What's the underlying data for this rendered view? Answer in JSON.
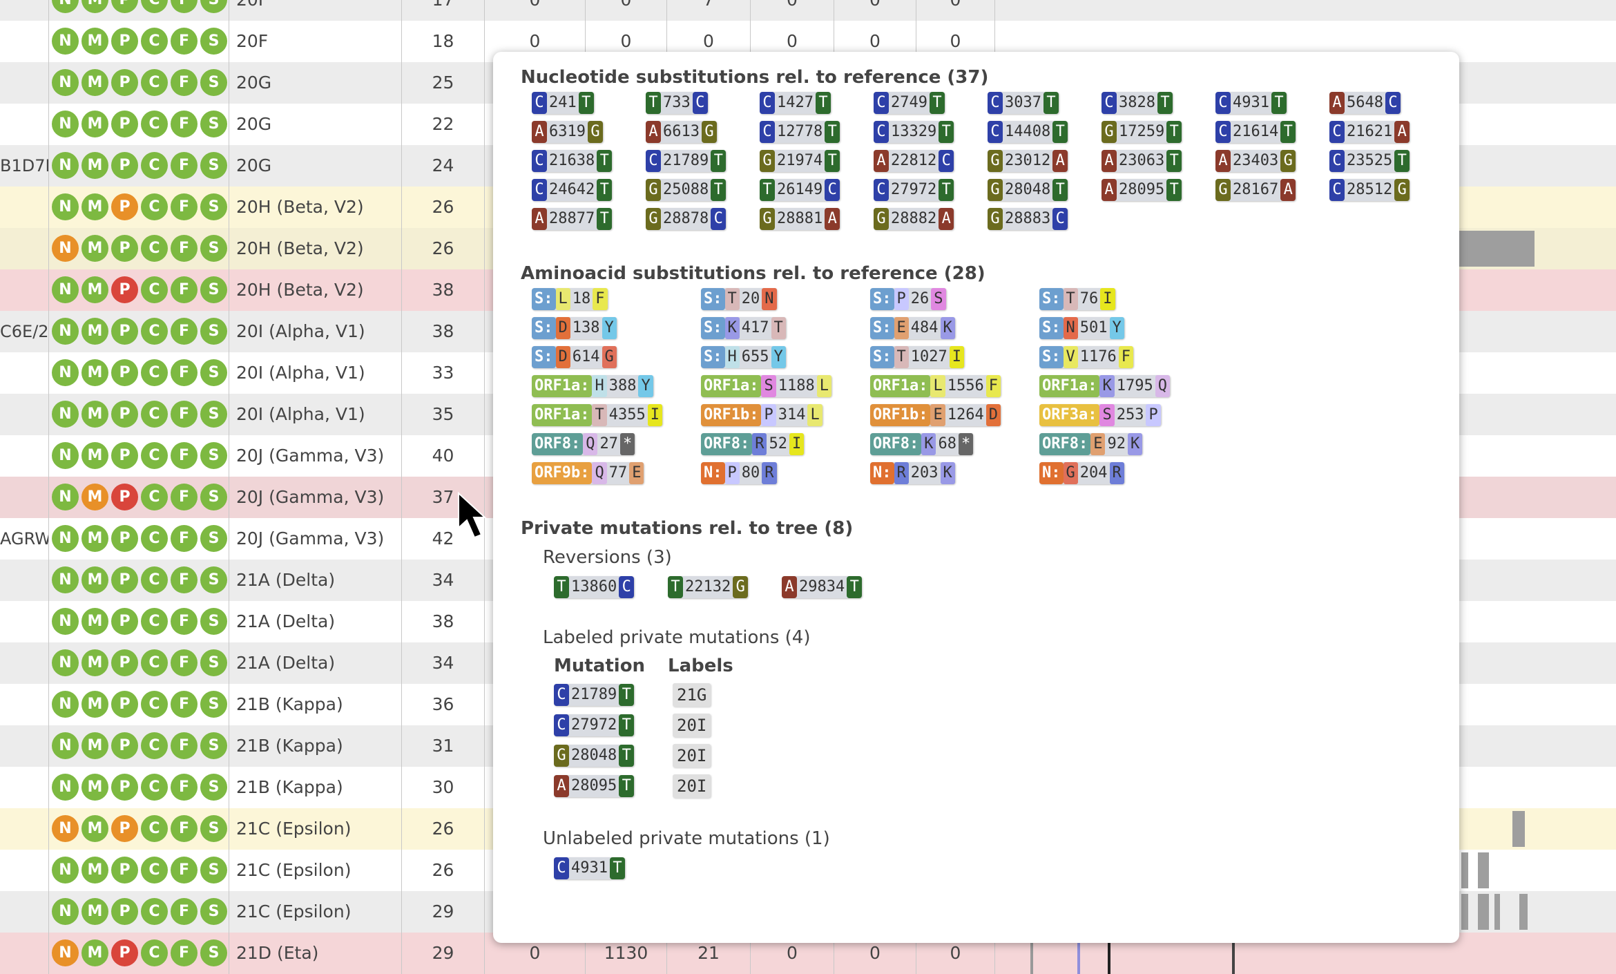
{
  "table": {
    "rows": [
      {
        "name": "",
        "qc": [
          "ok",
          "ok",
          "ok",
          "ok",
          "ok",
          "ok"
        ],
        "clade": "20F",
        "total": "17",
        "bg": "#ececec",
        "nums": [
          "0",
          "0",
          "7",
          "0",
          "0",
          "0"
        ]
      },
      {
        "name": "",
        "qc": [
          "ok",
          "ok",
          "ok",
          "ok",
          "ok",
          "ok"
        ],
        "clade": "20F",
        "total": "18",
        "bg": "#ffffff",
        "nums": [
          "0",
          "0",
          "0",
          "0",
          "0",
          "0"
        ]
      },
      {
        "name": "",
        "qc": [
          "ok",
          "ok",
          "ok",
          "ok",
          "ok",
          "ok"
        ],
        "clade": "20G",
        "total": "25",
        "bg": "#ececec",
        "nums": []
      },
      {
        "name": "",
        "qc": [
          "ok",
          "ok",
          "ok",
          "ok",
          "ok",
          "ok"
        ],
        "clade": "20G",
        "total": "22",
        "bg": "#ffffff",
        "nums": []
      },
      {
        "name": "B1D7I",
        "qc": [
          "ok",
          "ok",
          "ok",
          "ok",
          "ok",
          "ok"
        ],
        "clade": "20G",
        "total": "24",
        "bg": "#ececec",
        "nums": []
      },
      {
        "name": "",
        "qc": [
          "ok",
          "ok",
          "med",
          "ok",
          "ok",
          "ok"
        ],
        "clade": "20H (Beta, V2)",
        "total": "26",
        "bg": "#fcf6d8",
        "nums": []
      },
      {
        "name": "",
        "qc": [
          "med",
          "ok",
          "ok",
          "ok",
          "ok",
          "ok"
        ],
        "clade": "20H (Beta, V2)",
        "total": "26",
        "bg": "#f4efd4",
        "nums": []
      },
      {
        "name": "",
        "qc": [
          "ok",
          "ok",
          "bad",
          "ok",
          "ok",
          "ok"
        ],
        "clade": "20H (Beta, V2)",
        "total": "38",
        "bg": "#f5d6d8",
        "nums": []
      },
      {
        "name": "C6E/2",
        "qc": [
          "ok",
          "ok",
          "ok",
          "ok",
          "ok",
          "ok"
        ],
        "clade": "20I (Alpha, V1)",
        "total": "38",
        "bg": "#ececec",
        "nums": []
      },
      {
        "name": "",
        "qc": [
          "ok",
          "ok",
          "ok",
          "ok",
          "ok",
          "ok"
        ],
        "clade": "20I (Alpha, V1)",
        "total": "33",
        "bg": "#ffffff",
        "nums": []
      },
      {
        "name": "",
        "qc": [
          "ok",
          "ok",
          "ok",
          "ok",
          "ok",
          "ok"
        ],
        "clade": "20I (Alpha, V1)",
        "total": "35",
        "bg": "#ececec",
        "nums": []
      },
      {
        "name": "",
        "qc": [
          "ok",
          "ok",
          "ok",
          "ok",
          "ok",
          "ok"
        ],
        "clade": "20J (Gamma, V3)",
        "total": "40",
        "bg": "#ffffff",
        "nums": []
      },
      {
        "name": "",
        "qc": [
          "ok",
          "med",
          "bad",
          "ok",
          "ok",
          "ok"
        ],
        "clade": "20J (Gamma, V3)",
        "total": "37",
        "bg": "#f0d5d7",
        "nums": []
      },
      {
        "name": "AGRW",
        "qc": [
          "ok",
          "ok",
          "ok",
          "ok",
          "ok",
          "ok"
        ],
        "clade": "20J (Gamma, V3)",
        "total": "42",
        "bg": "#ffffff",
        "nums": []
      },
      {
        "name": "",
        "qc": [
          "ok",
          "ok",
          "ok",
          "ok",
          "ok",
          "ok"
        ],
        "clade": "21A (Delta)",
        "total": "34",
        "bg": "#ececec",
        "nums": []
      },
      {
        "name": "",
        "qc": [
          "ok",
          "ok",
          "ok",
          "ok",
          "ok",
          "ok"
        ],
        "clade": "21A (Delta)",
        "total": "38",
        "bg": "#ffffff",
        "nums": []
      },
      {
        "name": "",
        "qc": [
          "ok",
          "ok",
          "ok",
          "ok",
          "ok",
          "ok"
        ],
        "clade": "21A (Delta)",
        "total": "34",
        "bg": "#ececec",
        "nums": []
      },
      {
        "name": "",
        "qc": [
          "ok",
          "ok",
          "ok",
          "ok",
          "ok",
          "ok"
        ],
        "clade": "21B (Kappa)",
        "total": "36",
        "bg": "#ffffff",
        "nums": []
      },
      {
        "name": "",
        "qc": [
          "ok",
          "ok",
          "ok",
          "ok",
          "ok",
          "ok"
        ],
        "clade": "21B (Kappa)",
        "total": "31",
        "bg": "#ececec",
        "nums": []
      },
      {
        "name": "",
        "qc": [
          "ok",
          "ok",
          "ok",
          "ok",
          "ok",
          "ok"
        ],
        "clade": "21B (Kappa)",
        "total": "30",
        "bg": "#ffffff",
        "nums": []
      },
      {
        "name": "",
        "qc": [
          "med",
          "ok",
          "med",
          "ok",
          "ok",
          "ok"
        ],
        "clade": "21C (Epsilon)",
        "total": "26",
        "bg": "#fcf6d8",
        "nums": []
      },
      {
        "name": "",
        "qc": [
          "ok",
          "ok",
          "ok",
          "ok",
          "ok",
          "ok"
        ],
        "clade": "21C (Epsilon)",
        "total": "26",
        "bg": "#ffffff",
        "nums": []
      },
      {
        "name": "",
        "qc": [
          "ok",
          "ok",
          "ok",
          "ok",
          "ok",
          "ok"
        ],
        "clade": "21C (Epsilon)",
        "total": "29",
        "bg": "#ececec",
        "nums": []
      },
      {
        "name": "",
        "qc": [
          "med",
          "ok",
          "bad",
          "ok",
          "ok",
          "ok"
        ],
        "clade": "21D (Eta)",
        "total": "29",
        "bg": "#f5d6d8",
        "nums": [
          "0",
          "1130",
          "21",
          "0",
          "0",
          "0"
        ]
      }
    ],
    "qc_letters": [
      "N",
      "M",
      "P",
      "C",
      "F",
      "S"
    ]
  },
  "popup": {
    "nuc_title": "Nucleotide substitutions rel. to reference (37)",
    "nuc": [
      [
        "C",
        "241",
        "T"
      ],
      [
        "T",
        "733",
        "C"
      ],
      [
        "C",
        "1427",
        "T"
      ],
      [
        "C",
        "2749",
        "T"
      ],
      [
        "C",
        "3037",
        "T"
      ],
      [
        "C",
        "3828",
        "T"
      ],
      [
        "C",
        "4931",
        "T"
      ],
      [
        "A",
        "5648",
        "C"
      ],
      [
        "A",
        "6319",
        "G"
      ],
      [
        "A",
        "6613",
        "G"
      ],
      [
        "C",
        "12778",
        "T"
      ],
      [
        "C",
        "13329",
        "T"
      ],
      [
        "C",
        "14408",
        "T"
      ],
      [
        "G",
        "17259",
        "T"
      ],
      [
        "C",
        "21614",
        "T"
      ],
      [
        "C",
        "21621",
        "A"
      ],
      [
        "C",
        "21638",
        "T"
      ],
      [
        "C",
        "21789",
        "T"
      ],
      [
        "G",
        "21974",
        "T"
      ],
      [
        "A",
        "22812",
        "C"
      ],
      [
        "G",
        "23012",
        "A"
      ],
      [
        "A",
        "23063",
        "T"
      ],
      [
        "A",
        "23403",
        "G"
      ],
      [
        "C",
        "23525",
        "T"
      ],
      [
        "C",
        "24642",
        "T"
      ],
      [
        "G",
        "25088",
        "T"
      ],
      [
        "T",
        "26149",
        "C"
      ],
      [
        "C",
        "27972",
        "T"
      ],
      [
        "G",
        "28048",
        "T"
      ],
      [
        "A",
        "28095",
        "T"
      ],
      [
        "G",
        "28167",
        "A"
      ],
      [
        "C",
        "28512",
        "G"
      ],
      [
        "A",
        "28877",
        "T"
      ],
      [
        "G",
        "28878",
        "C"
      ],
      [
        "G",
        "28881",
        "A"
      ],
      [
        "G",
        "28882",
        "A"
      ],
      [
        "G",
        "28883",
        "C"
      ]
    ],
    "aa_title": "Aminoacid substitutions rel. to reference (28)",
    "aa": [
      [
        "S:",
        "L",
        "18",
        "F"
      ],
      [
        "S:",
        "T",
        "20",
        "N"
      ],
      [
        "S:",
        "P",
        "26",
        "S"
      ],
      [
        "S:",
        "T",
        "76",
        "I"
      ],
      [
        "S:",
        "D",
        "138",
        "Y"
      ],
      [
        "S:",
        "K",
        "417",
        "T"
      ],
      [
        "S:",
        "E",
        "484",
        "K"
      ],
      [
        "S:",
        "N",
        "501",
        "Y"
      ],
      [
        "S:",
        "D",
        "614",
        "G"
      ],
      [
        "S:",
        "H",
        "655",
        "Y"
      ],
      [
        "S:",
        "T",
        "1027",
        "I"
      ],
      [
        "S:",
        "V",
        "1176",
        "F"
      ],
      [
        "ORF1a:",
        "H",
        "388",
        "Y"
      ],
      [
        "ORF1a:",
        "S",
        "1188",
        "L"
      ],
      [
        "ORF1a:",
        "L",
        "1556",
        "F"
      ],
      [
        "ORF1a:",
        "K",
        "1795",
        "Q"
      ],
      [
        "ORF1a:",
        "T",
        "4355",
        "I"
      ],
      [
        "ORF1b:",
        "P",
        "314",
        "L"
      ],
      [
        "ORF1b:",
        "E",
        "1264",
        "D"
      ],
      [
        "ORF3a:",
        "S",
        "253",
        "P"
      ],
      [
        "ORF8:",
        "Q",
        "27",
        "*"
      ],
      [
        "ORF8:",
        "R",
        "52",
        "I"
      ],
      [
        "ORF8:",
        "K",
        "68",
        "*"
      ],
      [
        "ORF8:",
        "E",
        "92",
        "K"
      ],
      [
        "ORF9b:",
        "Q",
        "77",
        "E"
      ],
      [
        "N:",
        "P",
        "80",
        "R"
      ],
      [
        "N:",
        "R",
        "203",
        "K"
      ],
      [
        "N:",
        "G",
        "204",
        "R"
      ]
    ],
    "private_title": "Private mutations rel. to tree (8)",
    "reversions_title": "Reversions (3)",
    "reversions": [
      [
        "T",
        "13860",
        "C"
      ],
      [
        "T",
        "22132",
        "G"
      ],
      [
        "A",
        "29834",
        "T"
      ]
    ],
    "labeled_title": "Labeled private mutations (4)",
    "labeled_col_mutation": "Mutation",
    "labeled_col_labels": "Labels",
    "labeled": [
      {
        "mut": [
          "C",
          "21789",
          "T"
        ],
        "label": "21G"
      },
      {
        "mut": [
          "C",
          "27972",
          "T"
        ],
        "label": "20I"
      },
      {
        "mut": [
          "G",
          "28048",
          "T"
        ],
        "label": "20I"
      },
      {
        "mut": [
          "A",
          "28095",
          "T"
        ],
        "label": "20I"
      }
    ],
    "unlabeled_title": "Unlabeled private mutations (1)",
    "unlabeled": [
      [
        "C",
        "4931",
        "T"
      ]
    ]
  },
  "colors": {
    "A": "#8b3a2b",
    "C": "#2e40a8",
    "G": "#6b6b1e",
    "T": "#2d6b2d",
    "qc_ok": "#7db941",
    "qc_med": "#e89028",
    "qc_bad": "#d9453b"
  }
}
